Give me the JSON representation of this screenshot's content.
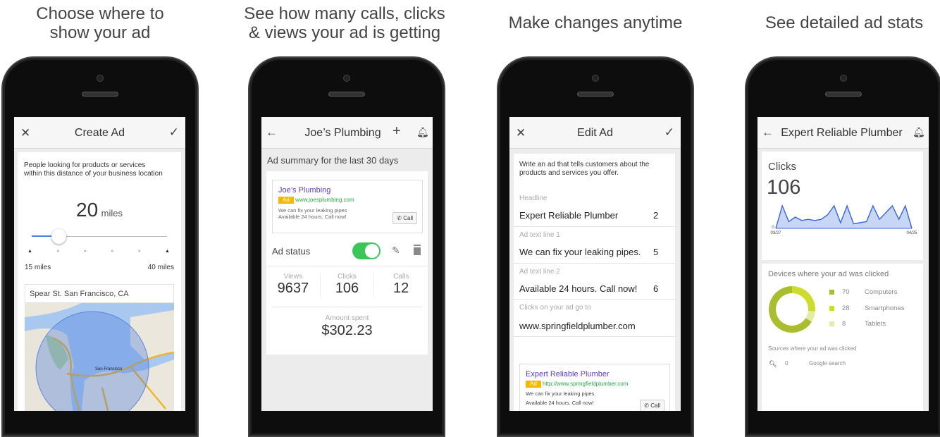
{
  "captions": [
    "Choose where to\nshow your ad",
    "See how many calls, clicks\n& views your ad is getting",
    "Make changes anytime",
    "See detailed ad stats"
  ],
  "screen1": {
    "title": "Create Ad",
    "description": "People looking for products or services within this distance of your business location",
    "distance_value": "20",
    "distance_unit": "miles",
    "slider_min_label": "15 miles",
    "slider_max_label": "40 miles",
    "slider_fraction": 0.2,
    "location": "Spear St. San Francisco, CA",
    "map_label": "San Francisco"
  },
  "screen2": {
    "title": "Joe’s Plumbing",
    "summary": "Ad summary for the last 30 days",
    "ad": {
      "headline": "Joe’s Plumbing",
      "badge": "Ad",
      "url": "www.joesplumbing.com",
      "line1": "We can fix your leaking pipes",
      "line2": "Available 24 hours. Call now!",
      "call": "Call"
    },
    "status_label": "Ad status",
    "status_on": true,
    "stats": [
      {
        "label": "Views",
        "value": "9637"
      },
      {
        "label": "Clicks",
        "value": "106"
      },
      {
        "label": "Calls",
        "value": "12"
      }
    ],
    "amount_label": "Amount spent",
    "amount": "$302.23",
    "colors": {
      "toggle": "#3cc65a",
      "headline": "#5a3fc0",
      "url": "#2aa846",
      "badge": "#f5b800"
    }
  },
  "screen3": {
    "title": "Edit Ad",
    "intro": "Write an ad that tells customers about the products and services you offer.",
    "fields": [
      {
        "label": "Headline",
        "value": "Expert Reliable Plumber",
        "count": "2"
      },
      {
        "label": "Ad text line 1",
        "value": "We can fix your leaking pipes.",
        "count": "5"
      },
      {
        "label": "Ad text line 2",
        "value": "Available 24 hours. Call now!",
        "count": "6"
      },
      {
        "label": "Clicks on your ad go to",
        "value": "www.springfieldplumber.com",
        "count": ""
      }
    ],
    "preview": {
      "headline": "Expert Reliable Plumber",
      "badge": "Ad",
      "url": "http://www.springfieldplumber.com",
      "line1": "We can fix your leaking pipes.",
      "line2": "Available 24 hours. Call now!",
      "call": "Call"
    }
  },
  "screen4": {
    "title": "Expert Reliable Plumber",
    "metric_label": "Clicks",
    "metric_value": "106",
    "chart_data": {
      "type": "area",
      "x_start_label": "03/27",
      "x_end_label": "04/25",
      "y_min_label": "0",
      "values": [
        0,
        10,
        3,
        5,
        3.5,
        4,
        3.5,
        4,
        6,
        10,
        2.5,
        10,
        2,
        2.5,
        3,
        10,
        4,
        7,
        10,
        4,
        10,
        0
      ],
      "color": "#3a64d8"
    },
    "devices_title": "Devices where your ad was clicked",
    "devices": [
      {
        "value": 70,
        "label": "Computers",
        "color": "#a9bd2f"
      },
      {
        "value": 28,
        "label": "Smartphones",
        "color": "#cddc2c"
      },
      {
        "value": 8,
        "label": "Tablets",
        "color": "#e3eca6"
      }
    ],
    "sources_title": "Sources where your ad was clicked",
    "sources": [
      {
        "value": "0",
        "label": "Google search"
      }
    ]
  }
}
